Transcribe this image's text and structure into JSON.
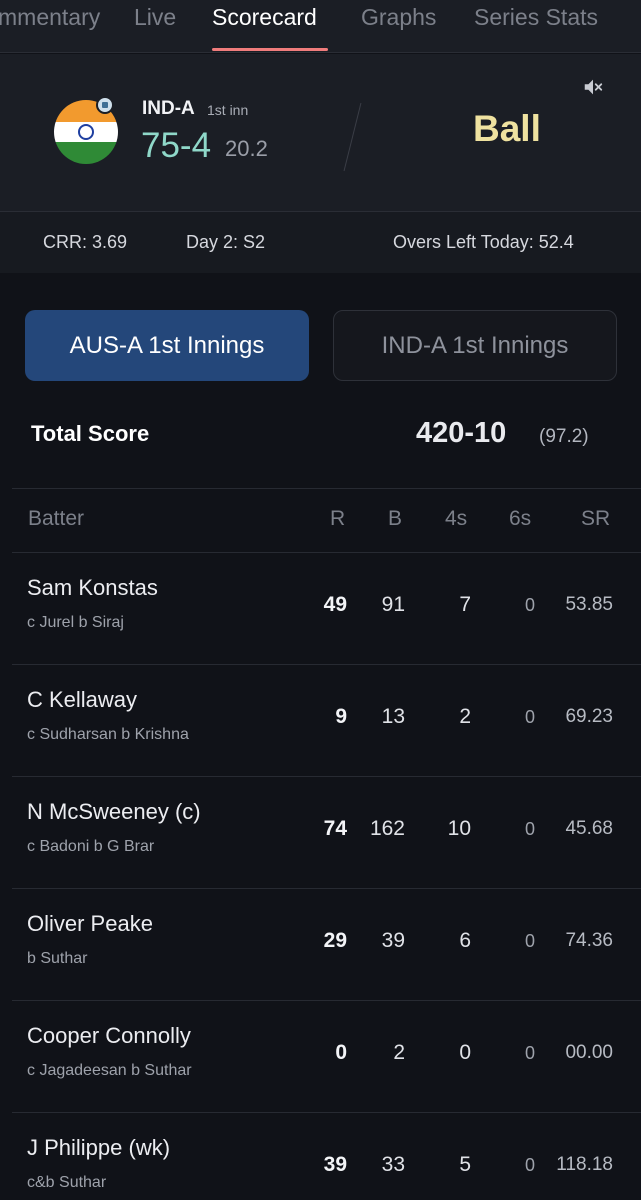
{
  "tabs": [
    {
      "label": "Commentary",
      "shown": "mmentary"
    },
    {
      "label": "Live"
    },
    {
      "label": "Scorecard"
    },
    {
      "label": "Graphs"
    },
    {
      "label": "Series Stats"
    }
  ],
  "header": {
    "team": "IND-A",
    "innings": "1st inn",
    "score": "75-4",
    "overs": "20.2",
    "status": "Ball"
  },
  "info": {
    "crr": "CRR:  3.69",
    "day": "Day 2: S2",
    "overs_left": "Overs Left Today: 52.4"
  },
  "innings_tabs": {
    "active": "AUS-A 1st Innings",
    "inactive": "IND-A 1st Innings"
  },
  "total": {
    "label": "Total Score",
    "value": "420-10",
    "overs": "(97.2)"
  },
  "table": {
    "headers": {
      "batter": "Batter",
      "r": "R",
      "b": "B",
      "fours": "4s",
      "sixes": "6s",
      "sr": "SR"
    },
    "rows": [
      {
        "name": "Sam Konstas",
        "dismissal": "c Jurel b Siraj",
        "r": "49",
        "b": "91",
        "fours": "7",
        "sixes": "0",
        "sr": "53.85"
      },
      {
        "name": "C Kellaway",
        "dismissal": "c Sudharsan b Krishna",
        "r": "9",
        "b": "13",
        "fours": "2",
        "sixes": "0",
        "sr": "69.23"
      },
      {
        "name": "N McSweeney (c)",
        "dismissal": "c Badoni b G Brar",
        "r": "74",
        "b": "162",
        "fours": "10",
        "sixes": "0",
        "sr": "45.68"
      },
      {
        "name": "Oliver Peake",
        "dismissal": "b Suthar",
        "r": "29",
        "b": "39",
        "fours": "6",
        "sixes": "0",
        "sr": "74.36"
      },
      {
        "name": "Cooper Connolly",
        "dismissal": "c Jagadeesan b Suthar",
        "r": "0",
        "b": "2",
        "fours": "0",
        "sixes": "0",
        "sr": "00.00"
      },
      {
        "name": "J Philippe (wk)",
        "dismissal": "c&b Suthar",
        "r": "39",
        "b": "33",
        "fours": "5",
        "sixes": "0",
        "sr": "118.18"
      }
    ]
  },
  "colors": {
    "accent_underline": "#f07c7c",
    "score_teal": "#8fd8c9",
    "status_yellow": "#efe2a0",
    "active_tab_blue": "#24477a"
  },
  "icons": {
    "mute": "speaker-muted-icon",
    "flag": "india-flag-icon"
  }
}
